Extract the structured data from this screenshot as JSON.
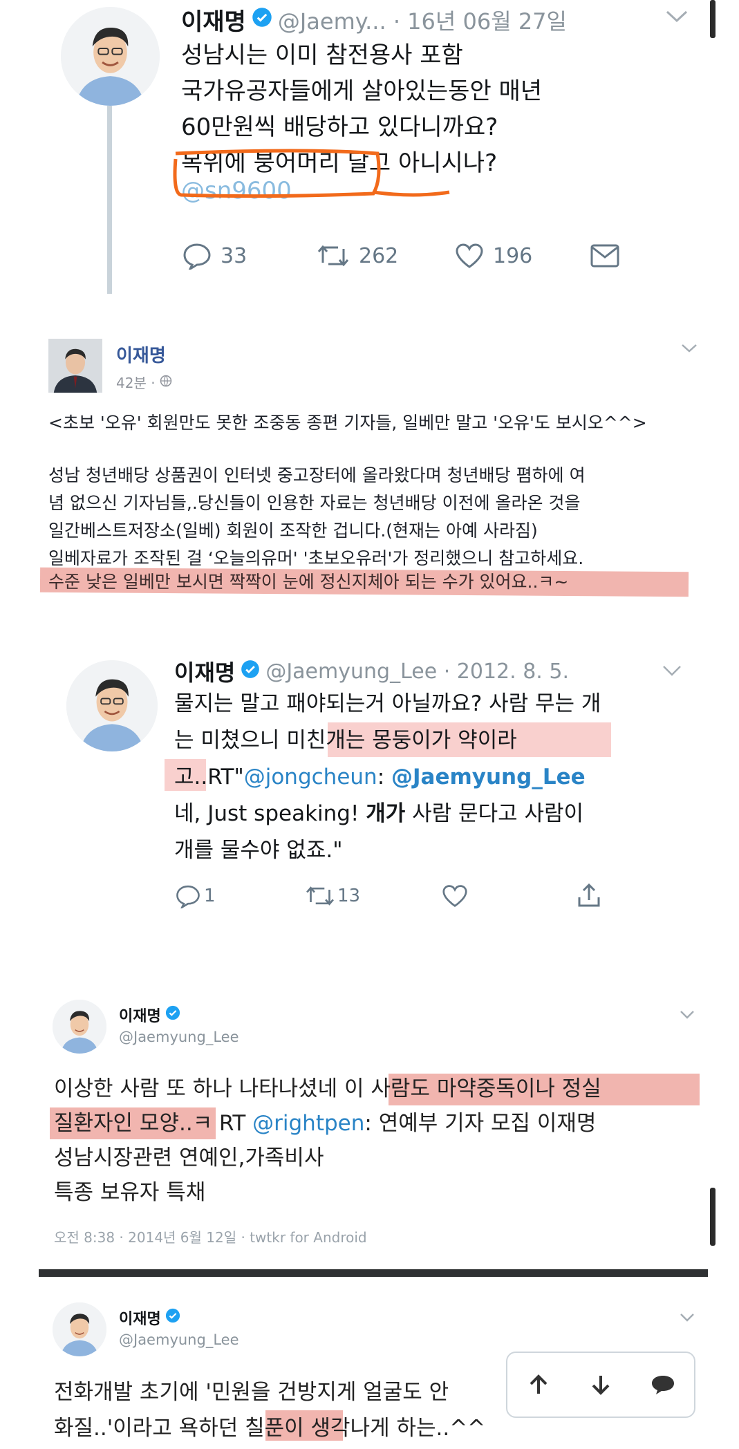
{
  "tweet1": {
    "name": "이재명",
    "handle_date": "@Jaemy... · 16년 06월 27일",
    "lines": [
      "성남시는 이미 참전용사 포함",
      "국가유공자들에게 살아있는동안 매년",
      "60만원씩 배당하고 있다니까요?"
    ],
    "line4_pre": "목위에 붕어머리",
    "line4_post": " 달고 아니시나?",
    "mention": "@sn9600",
    "replies": "33",
    "retweets": "262",
    "likes": "196"
  },
  "fb": {
    "name": "이재명",
    "time": "42분 ·",
    "title": "<초보 '오유' 회원만도 못한 조중동 종편 기자들, 일베만 말고 '오유'도 보시오^^>",
    "lines": [
      "성남 청년배당 상품권이 인터넷 중고장터에 올라왔다며 청년배당 폄하에 여",
      "념 없으신 기자님들,.당신들이 인용한 자료는 청년배당 이전에 올라온 것을",
      "일간베스트저장소(일베) 회원이 조작한 겁니다.(현재는 아예 사라짐)",
      "일베자료가 조작된 걸 ‘오늘의유머' '초보오유러'가 정리했으니 참고하세요."
    ],
    "highlight": "수준 낮은 일베만 보시면 짝짝이 눈에 정신지체아 되는 수가 있어요..ㅋ~"
  },
  "tweet2": {
    "name": "이재명",
    "handle_date": "@Jaemyung_Lee · 2012. 8. 5.",
    "line1": "물지는 말고 패야되는거 아닐까요? 사람 무는 개",
    "line2_pre": "는 미쳤으니 ",
    "line2_hl": "미친개는 몽둥이가 약이라",
    "line3_hl": "고..",
    "line3_rt": "RT\"",
    "line3_m1": "@jongcheun",
    "line3_colon": ": ",
    "line3_m2": "@Jaemyung_Lee",
    "line4_pre": "네, Just speaking! ",
    "line4_bold": "개가",
    "line4_post": " 사람 문다고 사람이",
    "line5": "개를 물수야 없죠.\"",
    "replies": "1",
    "retweets": "13"
  },
  "tweet3": {
    "name": "이재명",
    "handle": "@Jaemyung_Lee",
    "line1_pre": "이상한 사람 또 하나 나타나셨네 ",
    "line1_hl": "이 사람도 마약중독이나 정실",
    "line2_hl": "질환자인 모양..",
    "line2_post": "ㅋ RT ",
    "line2_mention": "@rightpen",
    "line2_tail": ": 연예부 기자 모집 이재명",
    "line3": "성남시장관련 연예인,가족비사",
    "line4": "특종 보유자 특채",
    "meta": "오전 8:38 · 2014년 6월 12일 · twtkr for Android"
  },
  "tweet4": {
    "name": "이재명",
    "handle": "@Jaemyung_Lee",
    "line1": "전화개발 초기에 '민원을 건방지게 얼굴도 안",
    "line2_pre": "화질..'이라고 욕하던 ",
    "line2_hl": "칠푼이",
    "line2_post": " 생각나게 하는..^^"
  },
  "colors": {
    "verified": "#1da1f2",
    "link": "#2a84c6",
    "highlight": "#e6786e",
    "marker": "#f26a1b"
  },
  "icons": [
    "chevron-down-icon",
    "reply-icon",
    "retweet-icon",
    "heart-icon",
    "mail-icon",
    "share-icon",
    "arrow-up-icon",
    "arrow-down-icon",
    "chat-bubble-icon",
    "globe-icon",
    "verified-icon"
  ]
}
